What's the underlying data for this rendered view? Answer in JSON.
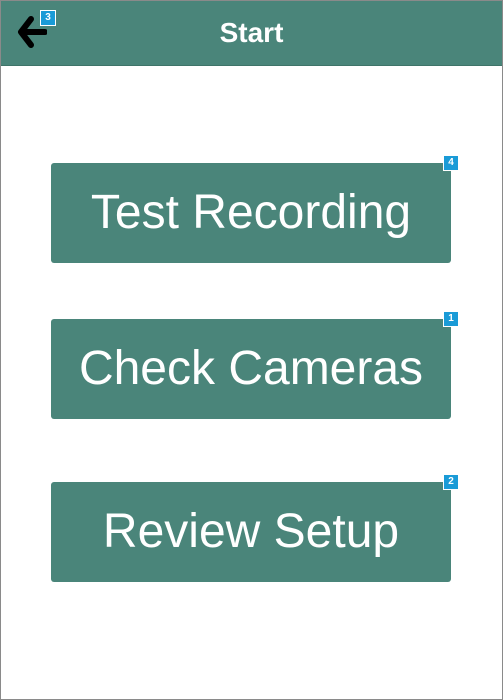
{
  "header": {
    "title": "Start",
    "back_icon": "arrow-left-icon",
    "back_badge": "3"
  },
  "buttons": [
    {
      "label": "Test Recording",
      "badge": "4"
    },
    {
      "label": "Check Cameras",
      "badge": "1"
    },
    {
      "label": "Review Setup",
      "badge": "2"
    }
  ],
  "colors": {
    "primary": "#4a857a",
    "badge": "#1a9bd7",
    "text": "#ffffff"
  }
}
